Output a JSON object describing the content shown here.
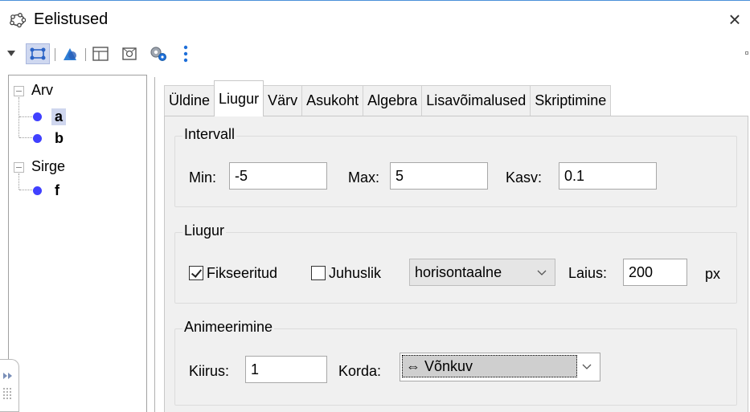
{
  "window": {
    "title": "Eelistused",
    "close_label": "×"
  },
  "toolbar": {
    "items": [
      "dropdown-triangle-icon",
      "slider-object-icon",
      "shapes-icon",
      "layout-icon",
      "defaults-icon",
      "advanced-settings-icon",
      "more-menu-icon"
    ],
    "colors": {
      "accent_blue": "#1e6fd9",
      "gear_gray": "#9fa6b0"
    }
  },
  "tree": {
    "groups": [
      {
        "label": "Arv",
        "items": [
          "a",
          "b"
        ]
      },
      {
        "label": "Sirge",
        "items": [
          "f"
        ]
      }
    ],
    "selected": "a",
    "dot_color": "#4040ff"
  },
  "tabs": [
    "Üldine",
    "Liugur",
    "Värv",
    "Asukoht",
    "Algebra",
    "Lisavõimalused",
    "Skriptimine"
  ],
  "active_tab": "Liugur",
  "interval": {
    "title": "Intervall",
    "min_label": "Min:",
    "min_value": "-5",
    "max_label": "Max:",
    "max_value": "5",
    "step_label": "Kasv:",
    "step_value": "0.1"
  },
  "slider": {
    "title": "Liugur",
    "fixed_label": "Fikseeritud",
    "fixed_checked": true,
    "random_label": "Juhuslik",
    "random_checked": false,
    "orientation": "horisontaalne",
    "width_label": "Laius:",
    "width_value": "200",
    "width_unit": "px"
  },
  "animation": {
    "title": "Animeerimine",
    "speed_label": "Kiirus:",
    "speed_value": "1",
    "repeat_label": "Korda:",
    "repeat_value": "⇔ Võnkuv"
  }
}
